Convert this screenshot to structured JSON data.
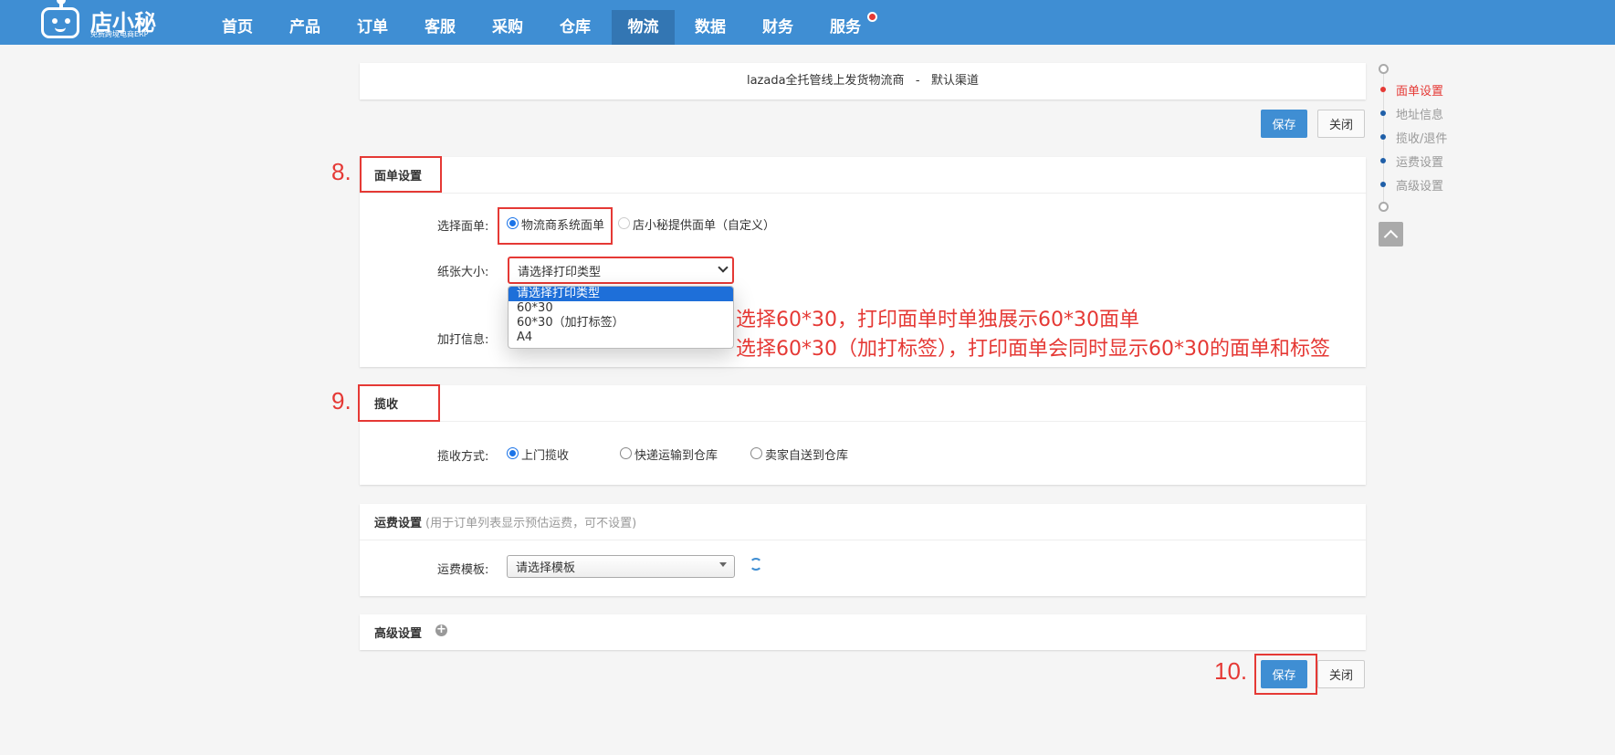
{
  "brand": {
    "name": "店小秘",
    "tagline": "免费跨境电商ERP"
  },
  "nav": [
    {
      "label": "首页"
    },
    {
      "label": "产品"
    },
    {
      "label": "订单"
    },
    {
      "label": "客服"
    },
    {
      "label": "采购"
    },
    {
      "label": "仓库"
    },
    {
      "label": "物流"
    },
    {
      "label": "数据"
    },
    {
      "label": "财务"
    },
    {
      "label": "服务"
    }
  ],
  "nav_active": "物流",
  "page": {
    "title": "lazada全托管线上发货物流商   -   默认渠道",
    "save_label": "保存",
    "close_label": "关闭"
  },
  "label_section": {
    "step": "8.",
    "title": "面单设置",
    "select_label_field": "选择面单:",
    "option_carrier": "物流商系统面单",
    "option_custom": "店小秘提供面单（自定义）",
    "paper_size_field": "纸张大小:",
    "paper_size_value": "请选择打印类型",
    "paper_size_options": [
      "请选择打印类型",
      "60*30",
      "60*30（加打标签）",
      "A4"
    ],
    "extra_print_field": "加打信息:"
  },
  "annotations": [
    "选择60*30，打印面单时单独展示60*30面单",
    "选择60*30（加打标签），打印面单会同时显示60*30的面单和标签"
  ],
  "pickup_section": {
    "step": "9.",
    "title": "揽收",
    "method_field": "揽收方式:",
    "options": [
      "上门揽收",
      "快递运输到仓库",
      "卖家自送到仓库"
    ]
  },
  "freight_section": {
    "title": "运费设置",
    "note": "(用于订单列表显示预估运费，可不设置)",
    "template_field": "运费模板:",
    "template_value": "请选择模板"
  },
  "advanced_section": {
    "title": "高级设置"
  },
  "bottom": {
    "step": "10.",
    "save_label": "保存",
    "close_label": "关闭"
  },
  "sidebar": [
    {
      "label": "面单设置",
      "active": true
    },
    {
      "label": "地址信息"
    },
    {
      "label": "揽收/退件"
    },
    {
      "label": "运费设置"
    },
    {
      "label": "高级设置"
    }
  ],
  "colors": {
    "nav_bg": "#3f8ed3",
    "nav_active": "#3376b3",
    "primary": "#3f8ed3",
    "annotation_red": "#e53935",
    "sidebar_dot": "#1f5fa8"
  }
}
